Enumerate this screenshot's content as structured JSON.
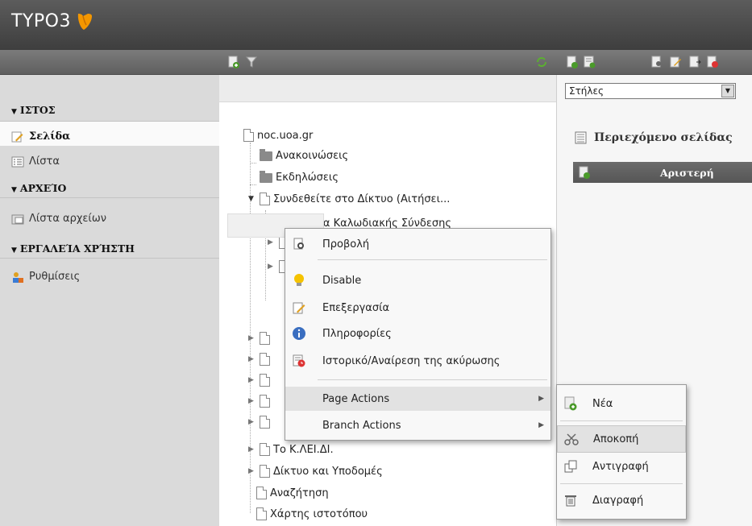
{
  "app": {
    "logo_text": "TYPO3"
  },
  "modmenu": {
    "sections": [
      {
        "title": "ΙΣΤΟΣ",
        "items": [
          {
            "label": "Σελίδα",
            "icon": "page-edit-icon"
          },
          {
            "label": "Λίστα",
            "icon": "list-icon"
          }
        ]
      },
      {
        "title": "ΑΡΧΕΊΟ",
        "items": [
          {
            "label": "Λίστα αρχείων",
            "icon": "filelist-icon"
          }
        ]
      },
      {
        "title": "ΕΡΓΑΛΕΊΑ ΧΡΉΣΤΗ",
        "items": [
          {
            "label": "Ρυθμίσεις",
            "icon": "user-settings-icon"
          }
        ]
      }
    ]
  },
  "tree": {
    "nodes": [
      "noc.uoa.gr",
      "Ανακοινώσεις",
      "Εκδηλώσεις",
      "Συνδεθείτε στο Δίκτυο (Αιτήσει...",
      "Υπηρεσία Καλωδιακής Σύνδεσης",
      "Το Κ.ΛΕΙ.ΔΙ.",
      "Δίκτυο και Υποδομές",
      "Αναζήτηση",
      "Χάρτης ιστοτόπου"
    ]
  },
  "content": {
    "columns_select": "Στήλες",
    "page_content_title": "Περιεχόμενο σελίδας",
    "column_left": "Αριστερή"
  },
  "context_menu": {
    "items": [
      {
        "label": "Προβολή",
        "icon": "view-icon"
      },
      {
        "label": "Disable",
        "icon": "lightbulb-icon"
      },
      {
        "label": "Επεξεργασία",
        "icon": "edit-icon"
      },
      {
        "label": "Πληροφορίες",
        "icon": "info-icon"
      },
      {
        "label": "Ιστορικό/Αναίρεση της ακύρωσης",
        "icon": "history-icon"
      },
      {
        "label": "Page Actions",
        "icon": ""
      },
      {
        "label": "Branch Actions",
        "icon": ""
      }
    ]
  },
  "submenu": {
    "items": [
      {
        "label": "Νέα",
        "icon": "new-page-icon"
      },
      {
        "label": "Αποκοπή",
        "icon": "cut-icon"
      },
      {
        "label": "Αντιγραφή",
        "icon": "copy-icon"
      },
      {
        "label": "Διαγραφή",
        "icon": "delete-icon"
      }
    ]
  },
  "colors": {
    "accent_orange": "#f49700",
    "header_dark": "#4a4a4a",
    "highlight": "#e2e2e2"
  }
}
